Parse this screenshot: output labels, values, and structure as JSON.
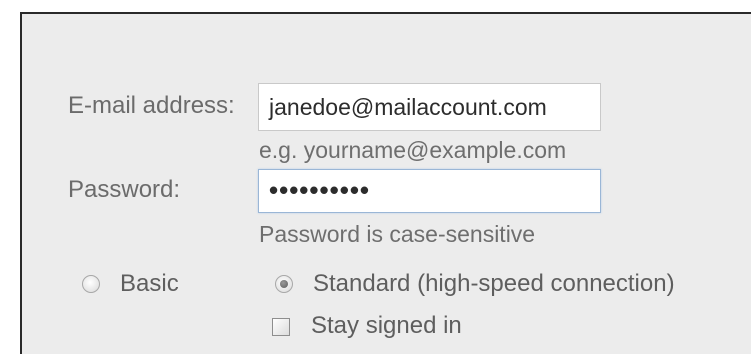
{
  "form": {
    "email_label": "E-mail address:",
    "email_value": "janedoe@mailaccount.com",
    "email_hint": "e.g. yourname@example.com",
    "password_label": "Password:",
    "password_value": "••••••••••",
    "password_hint": "Password is case-sensitive",
    "connection_options": [
      {
        "label": "Basic",
        "checked": false
      },
      {
        "label": "Standard (high-speed connection)",
        "checked": true
      }
    ],
    "stay_signed_in_label": "Stay signed in",
    "stay_signed_in_checked": false
  },
  "colors": {
    "panel_background": "#ececec",
    "label_text": "#6b6b6b",
    "input_border": "#c9c9c9",
    "password_focus_border": "#9ab6d6"
  }
}
